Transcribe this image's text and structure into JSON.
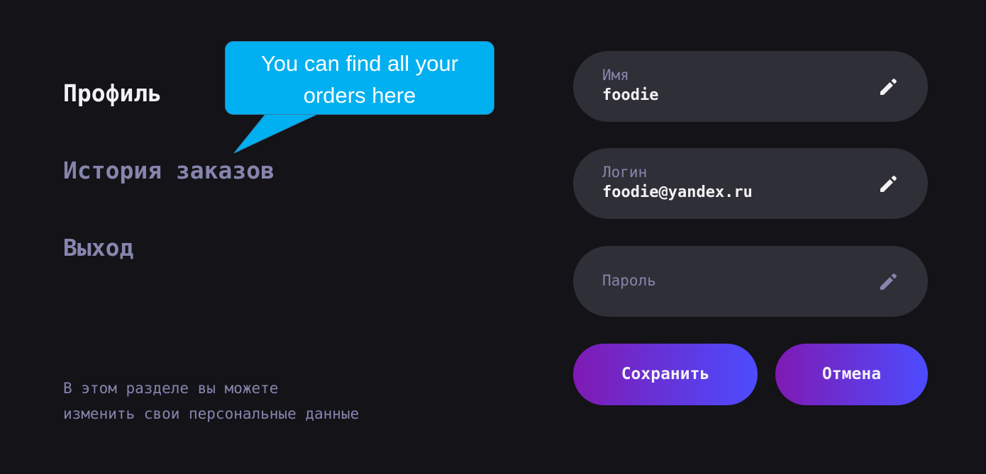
{
  "nav": {
    "profile": "Профиль",
    "order_history": "История заказов",
    "logout": "Выход",
    "active": "profile"
  },
  "caption": {
    "line1": "В этом разделе вы можете",
    "line2": "изменить свои персональные данные"
  },
  "callout": {
    "line1": "You can find all your",
    "line2": "orders here",
    "color": "#00b0f0"
  },
  "form": {
    "name": {
      "label": "Имя",
      "value": "foodie",
      "icon": "pencil-icon"
    },
    "login": {
      "label": "Логин",
      "value": "foodie@yandex.ru",
      "icon": "pencil-icon"
    },
    "password": {
      "placeholder": "Пароль",
      "value": "",
      "icon": "pencil-icon"
    }
  },
  "buttons": {
    "save": "Сохранить",
    "cancel": "Отмена"
  },
  "colors": {
    "background": "#131318",
    "field_background": "#2f2f37",
    "text_primary": "#f2f2f3",
    "text_inactive": "#8585ad",
    "button_gradient_start": "#801ab3",
    "button_gradient_end": "#4c4cff"
  }
}
